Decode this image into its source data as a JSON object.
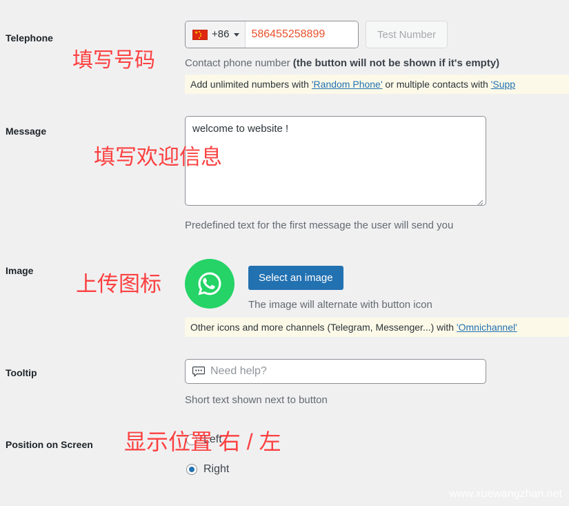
{
  "sections": {
    "telephone": {
      "label": "Telephone",
      "dial_code": "+86",
      "flag": "china-flag",
      "number": "586455258899",
      "number_placeholder": "",
      "test_button": "Test Number",
      "description_plain": "Contact phone number ",
      "description_bold": "(the button will not be shown if it's empty)",
      "notice_before": "Add unlimited numbers with ",
      "notice_link1": "'Random Phone'",
      "notice_middle": " or multiple contacts with ",
      "notice_link2": "'Supp",
      "annotation": "填写号码"
    },
    "message": {
      "label": "Message",
      "value": "welcome to website !",
      "placeholder": "",
      "description": "Predefined text for the first message the user will send you",
      "annotation": "填写欢迎信息"
    },
    "image": {
      "label": "Image",
      "icon": "whatsapp-icon",
      "select_button": "Select an image",
      "description": "The image will alternate with button icon",
      "notice_before": "Other icons and more channels (Telegram, Messenger...) with ",
      "notice_link": "'Omnichannel'",
      "annotation": "上传图标"
    },
    "tooltip": {
      "label": "Tooltip",
      "icon": "speech-bubble-icon",
      "value": "Need help?",
      "placeholder": "Need help?",
      "description": "Short text shown next to button"
    },
    "position": {
      "label": "Position on Screen",
      "options": [
        {
          "label": "Left",
          "checked": false
        },
        {
          "label": "Right",
          "checked": true
        }
      ],
      "annotation": "显示位置 右 / 左"
    }
  },
  "watermark": "www.xuewangzhan.net",
  "colors": {
    "accent": "#2271b1",
    "whatsapp_green": "#25d366",
    "annotation_red": "#fc4040",
    "notice_bg": "#fcf9e8",
    "page_bg": "#f0f0f1",
    "phone_value": "#e8502b"
  }
}
